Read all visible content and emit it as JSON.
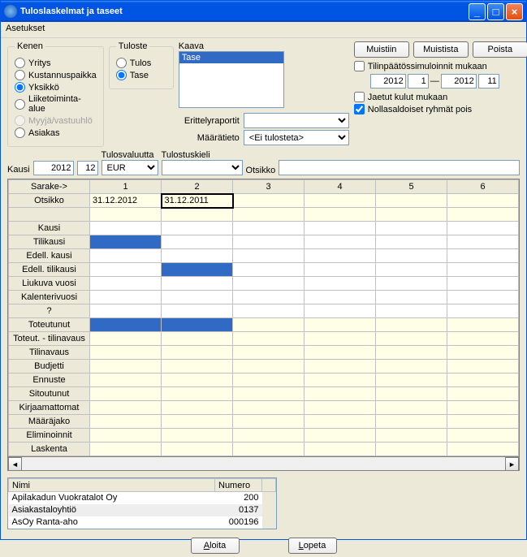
{
  "window": {
    "title": "Tuloslaskelmat ja taseet"
  },
  "menu": {
    "settings": "Asetukset"
  },
  "kenen": {
    "legend": "Kenen",
    "opts": [
      "Yritys",
      "Kustannuspaikka",
      "Yksikkö",
      "Liiketoiminta-alue",
      "Myyjä/vastuuhlö",
      "Asiakas"
    ]
  },
  "tuloste": {
    "legend": "Tuloste",
    "opts": [
      "Tulos",
      "Tase"
    ]
  },
  "kaava": {
    "label": "Kaava",
    "item": "Tase"
  },
  "buttons": {
    "muistiin": "Muistiin",
    "muistista": "Muistista",
    "poista": "Poista",
    "aloita": "Aloita",
    "lopeta": "Lopeta"
  },
  "sim": {
    "label": "Tilinpäätössimuloinnit mukaan",
    "y1": "2012",
    "m1": "1",
    "dash": "—",
    "y2": "2012",
    "m2": "11"
  },
  "checks": {
    "jaetut": "Jaetut kulut mukaan",
    "nolla": "Nollasaldoiset ryhmät pois"
  },
  "labels": {
    "erittely": "Erittelyraportit",
    "maaratieto": "Määrätieto",
    "maaratieto_val": "<Ei tulosteta>",
    "tulosvaluutta": "Tulosvaluutta",
    "tulostuskieli": "Tulostuskieli",
    "kausi": "Kausi",
    "otsikko": "Otsikko",
    "sarake": "Sarake->",
    "eur": "EUR"
  },
  "kausi": {
    "year": "2012",
    "month": "12"
  },
  "cols": [
    "1",
    "2",
    "3",
    "4",
    "5",
    "6"
  ],
  "rows": [
    "Otsikko",
    "",
    "Kausi",
    "Tilikausi",
    "Edell. kausi",
    "Edell. tilikausi",
    "Liukuva vuosi",
    "Kalenterivuosi",
    "?",
    "Toteutunut",
    "Toteut. - tilinavaus",
    "Tilinavaus",
    "Budjetti",
    "Ennuste",
    "Sitoutunut",
    "Kirjaamattomat",
    "Määräjako",
    "Eliminoinnit",
    "Laskenta"
  ],
  "cream_rows": [
    0,
    1,
    9,
    10,
    11,
    12,
    13,
    14,
    15,
    16,
    17,
    18
  ],
  "grid": {
    "c0_0": "31.12.2012",
    "c0_1": "31.12.2011"
  },
  "list": {
    "h1": "Nimi",
    "h2": "Numero",
    "rows": [
      {
        "n": "Apilakadun Vuokratalot Oy",
        "num": "200"
      },
      {
        "n": "Asiakastaloyhtiö",
        "num": "0137"
      },
      {
        "n": "AsOy Ranta-aho",
        "num": "000196"
      }
    ]
  }
}
